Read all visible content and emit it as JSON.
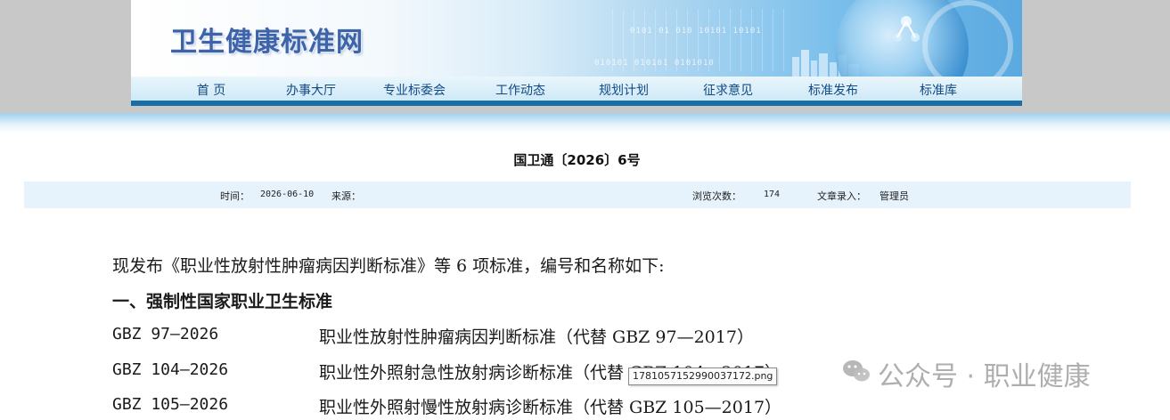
{
  "header": {
    "site_title": "卫生健康标准网",
    "binary_1": "0101 01 010 10101 10101",
    "binary_2": "010101 010101 0101010"
  },
  "nav": {
    "items": [
      {
        "label": "首 页"
      },
      {
        "label": "办事大厅"
      },
      {
        "label": "专业标委会"
      },
      {
        "label": "工作动态"
      },
      {
        "label": "规划计划"
      },
      {
        "label": "征求意见"
      },
      {
        "label": "标准发布"
      },
      {
        "label": "标准库"
      }
    ]
  },
  "article": {
    "title": "国卫通〔2026〕6号",
    "meta": {
      "time_label": "时间：",
      "time_value": "2026-06-10",
      "source_label": "来源：",
      "views_label": "浏览次数：",
      "views_value": "174",
      "author_label": "文章录入：",
      "author_value": "管理员"
    },
    "intro": "现发布《职业性放射性肿瘤病因判断标准》等 6 项标准，编号和名称如下:",
    "section_1": "一、强制性国家职业卫生标准",
    "standards": [
      {
        "code": "GBZ 97—2026",
        "name": "职业性放射性肿瘤病因判断标准（代替 GBZ 97—2017）"
      },
      {
        "code": "GBZ 104—2026",
        "name": "职业性外照射急性放射病诊断标准（代替 GBZ 104—2017）"
      },
      {
        "code": "GBZ 105—2026",
        "name": "职业性外照射慢性放射病诊断标准（代替 GBZ 105—2017）"
      }
    ]
  },
  "overlay": {
    "filename_tooltip": "1781057152990037172.png",
    "watermark": "公众号 · 职业健康"
  },
  "colors": {
    "nav_text": "#114a86",
    "nav_border": "#1a6ea8",
    "meta_bar_bg": "#e6f3fc",
    "title_blue": "#3d63a8"
  }
}
